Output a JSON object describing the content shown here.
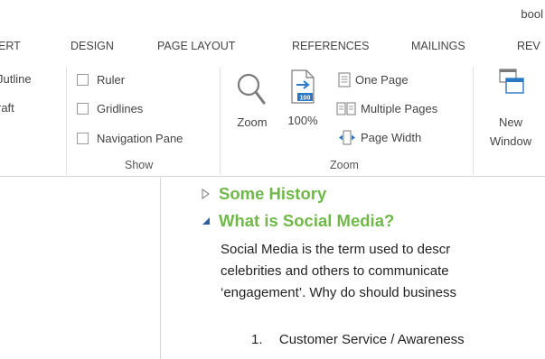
{
  "window": {
    "title": "bool"
  },
  "tabs": [
    {
      "label": "ERT"
    },
    {
      "label": "DESIGN"
    },
    {
      "label": "PAGE LAYOUT"
    },
    {
      "label": "REFERENCES"
    },
    {
      "label": "MAILINGS"
    },
    {
      "label": "REV"
    }
  ],
  "ribbon": {
    "views_group": {
      "outline_label": "Jutline",
      "draft_label": "raft"
    },
    "show_group": {
      "label": "Show",
      "ruler_label": "Ruler",
      "ruler_checked": false,
      "gridlines_label": "Gridlines",
      "gridlines_checked": false,
      "navigation_pane_label": "Navigation Pane",
      "navigation_pane_checked": false
    },
    "zoom_group": {
      "label": "Zoom",
      "zoom_label": "Zoom",
      "zoom100_label": "100%",
      "zoom100_badge": "100",
      "one_page_label": "One Page",
      "multiple_pages_label": "Multiple Pages",
      "page_width_label": "Page Width"
    },
    "window_group": {
      "new_window_line1": "New",
      "new_window_line2": "Window"
    }
  },
  "document": {
    "headings": [
      {
        "text": "Some History",
        "expanded": false
      },
      {
        "text": "What is Social Media?",
        "expanded": true
      }
    ],
    "paragraph_lines": [
      "Social Media is the term used to descr",
      "celebrities and others to communicate",
      "‘engagement’.  Why do should business"
    ],
    "list_items": [
      {
        "number": "1.",
        "text": "Customer Service / Awareness"
      }
    ]
  },
  "colors": {
    "heading_green": "#70b84a",
    "icon_blue": "#2b78c4",
    "text_gray": "#444444"
  }
}
